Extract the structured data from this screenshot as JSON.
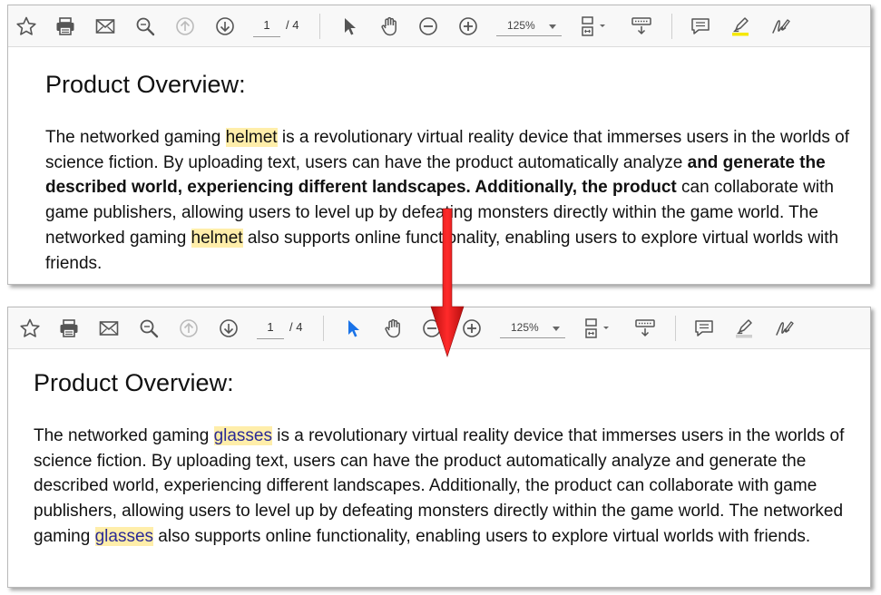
{
  "top": {
    "toolbar": {
      "page_current": "1",
      "page_total": "/ 4",
      "zoom": "125%"
    },
    "heading": "Product Overview:",
    "paragraph": {
      "s1": "The networked gaming ",
      "h1": "helmet",
      "s2": " is a revolutionary virtual reality device that immerses users in the worlds of science fiction. By uploading text, users can have the product automatically analyze ",
      "bold": "and generate the described world, experiencing different landscapes. Additionally, the product",
      "s3": " can collaborate with game publishers, allowing users to level up by defeating monsters directly within the game world. The networked gaming ",
      "h2": "helmet",
      "s4": " also supports online functionality, enabling users to explore virtual worlds with friends."
    }
  },
  "bottom": {
    "toolbar": {
      "page_current": "1",
      "page_total": "/ 4",
      "zoom": "125%"
    },
    "heading": "Product Overview:",
    "paragraph": {
      "s1": "The networked gaming ",
      "h1": "glasses",
      "s2": " is a revolutionary virtual reality device that immerses users in the worlds of science fiction. By uploading text, users can have the product automatically analyze and generate the described world, experiencing different landscapes. Additionally, the product can collaborate with game publishers, allowing users to level up by defeating monsters directly within the game world. The networked gaming ",
      "h2": "glasses",
      "s3": " also supports online functionality, enabling users to explore virtual worlds with friends."
    }
  },
  "colors": {
    "arrow": "#e31b1b",
    "highlight": "#ffeeaa",
    "highlight_text_new": "#2a2a96",
    "select_tool_active": "#1a73e8",
    "highlighter_active": "#f5e800"
  },
  "icons": {
    "toolbar": [
      "star-icon",
      "print-icon",
      "mail-icon",
      "zoom-search-icon",
      "arrow-up-circle-icon",
      "arrow-down-circle-icon",
      "cursor-select-icon",
      "hand-icon",
      "zoom-out-icon",
      "zoom-in-icon",
      "page-fit-icon",
      "keyboard-scroll-icon",
      "comment-icon",
      "highlighter-icon",
      "sign-icon"
    ]
  }
}
